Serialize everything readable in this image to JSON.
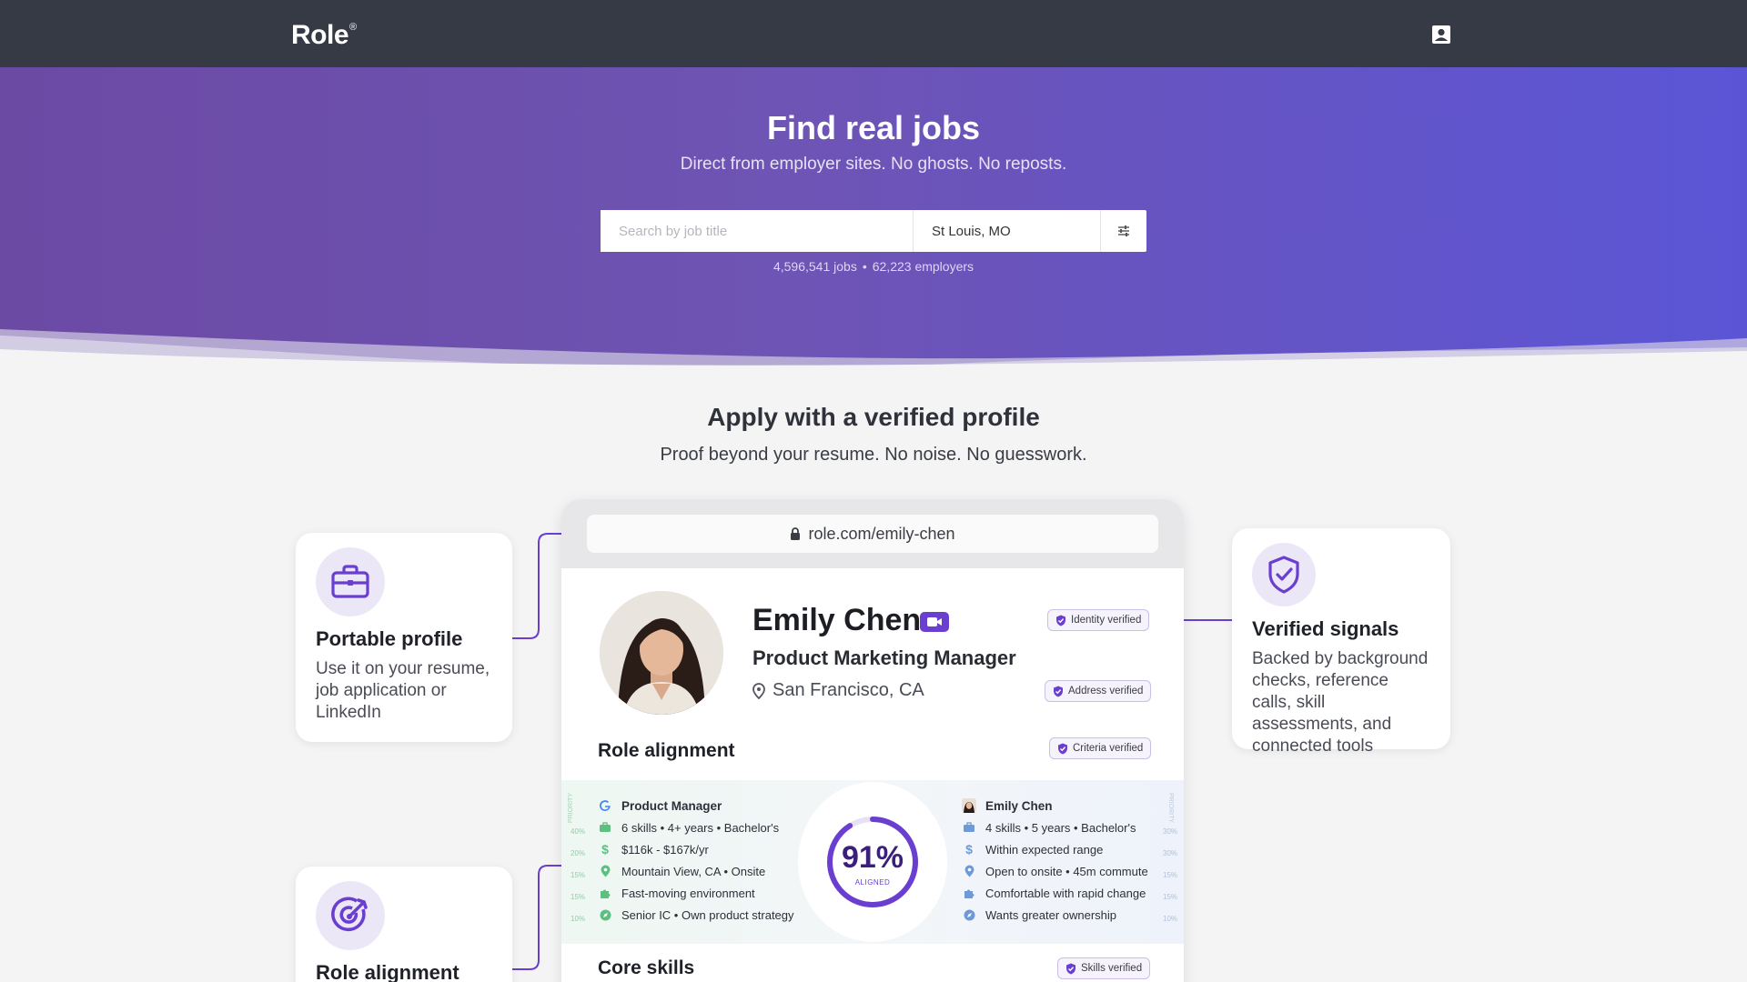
{
  "brand": {
    "logo": "Role",
    "mark": "®"
  },
  "hero": {
    "title": "Find real jobs",
    "subtitle": "Direct from employer sites. No ghosts. No reposts.",
    "search_placeholder": "Search by job title",
    "location_value": "St Louis, MO",
    "jobs_count": "4,596,541 jobs",
    "separator": "•",
    "employers_count": "62,223 employers"
  },
  "section": {
    "title": "Apply with a verified profile",
    "subtitle": "Proof beyond your resume. No noise. No guesswork."
  },
  "features": {
    "portable": {
      "title": "Portable profile",
      "desc": "Use it on your resume, job application or LinkedIn",
      "icon": "briefcase-icon"
    },
    "verified": {
      "title": "Verified signals",
      "desc": "Backed by background checks, reference calls, skill assessments, and connected tools",
      "icon": "shield-check-icon"
    },
    "alignment": {
      "title": "Role alignment",
      "icon": "target-icon"
    }
  },
  "browser": {
    "url": "role.com/emily-chen"
  },
  "profile": {
    "name": "Emily Chen",
    "job_title": "Product Marketing Manager",
    "location": "San Francisco, CA",
    "badges": {
      "identity": "Identity verified",
      "address": "Address verified",
      "criteria": "Criteria verified",
      "skills": "Skills verified"
    },
    "role_alignment_heading": "Role alignment",
    "core_skills_heading": "Core skills"
  },
  "alignment": {
    "percent": "91%",
    "label": "ALIGNED",
    "priority_label": "PRIORITY",
    "left_header": "Product Manager",
    "right_header": "Emily Chen",
    "left_rows": [
      "6 skills • 4+ years • Bachelor's",
      "$116k - $167k/yr",
      "Mountain View, CA • Onsite",
      "Fast-moving environment",
      "Senior IC • Own product strategy"
    ],
    "right_rows": [
      "4 skills • 5 years • Bachelor's",
      "Within expected range",
      "Open to onsite • 45m commute",
      "Comfortable with rapid change",
      "Wants greater ownership"
    ],
    "left_weights": [
      "40%",
      "20%",
      "15%",
      "15%",
      "10%"
    ],
    "right_weights": [
      "30%",
      "30%",
      "15%",
      "15%",
      "10%"
    ]
  },
  "colors": {
    "accent": "#6a3fd0",
    "topbar": "#363a44"
  }
}
